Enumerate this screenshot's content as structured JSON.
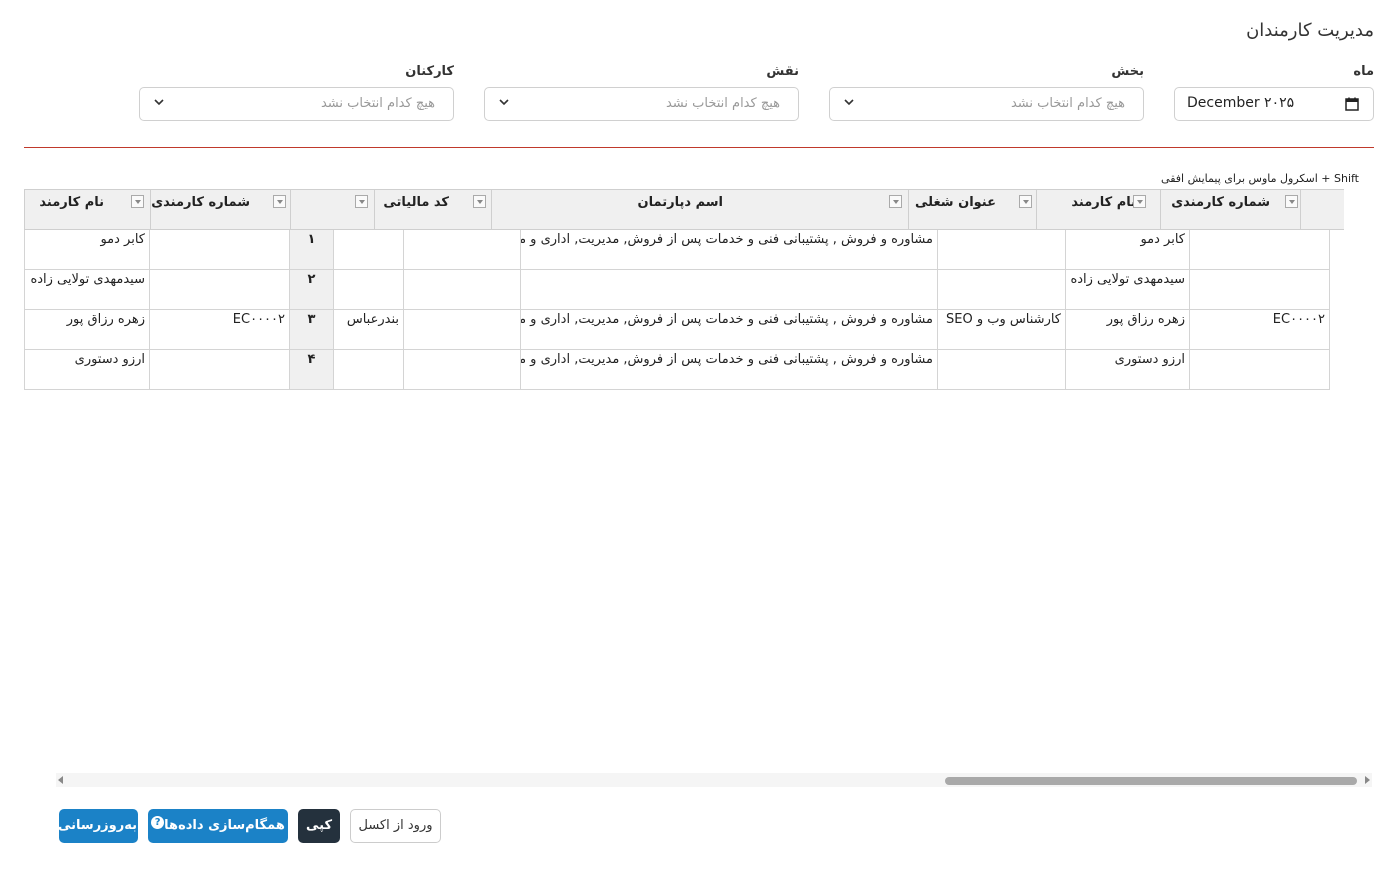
{
  "page": {
    "title": "مدیریت کارمندان"
  },
  "filters": {
    "month": {
      "label": "ماه",
      "value": "December ۲۰۲۵"
    },
    "section": {
      "label": "بخش",
      "placeholder": "هیچ کدام انتخاب نشد"
    },
    "role": {
      "label": "نقش",
      "placeholder": "هیچ کدام انتخاب نشد"
    },
    "staff": {
      "label": "کارکنان",
      "placeholder": "هیچ کدام انتخاب نشد"
    }
  },
  "grid": {
    "hint": "Shift + اسکرول ماوس برای پیمایش افقی",
    "headers": {
      "emp_number": "شماره کارمندی",
      "emp_name": "نام کارمند",
      "job_title": "عنوان شغلی",
      "dept_name": "اسم دپارتمان",
      "tax_code": "کد مالیاتی",
      "emp_number_2": "شماره کارمندی",
      "emp_name_2": "نام کارمند"
    },
    "rows": [
      {
        "emp_number": "",
        "emp_name": "کابر دمو",
        "job_title": "",
        "dept_name": "مشاوره و فروش , پشتیبانی فنی و خدمات پس از فروش, مدیریت, اداری و مالی",
        "tax_code": "",
        "city": "",
        "row_num": "۱",
        "emp_number_2": "",
        "emp_name_2": "کابر دمو"
      },
      {
        "emp_number": "",
        "emp_name": "سیدمهدی تولایی زاده",
        "job_title": "",
        "dept_name": "",
        "tax_code": "",
        "city": "",
        "row_num": "۲",
        "emp_number_2": "",
        "emp_name_2": "سیدمهدی تولایی زاده"
      },
      {
        "emp_number": "EC۰۰۰۰۲",
        "emp_name": "زهره رزاق پور",
        "job_title": "کارشناس وب و SEO",
        "dept_name": "مشاوره و فروش , پشتیبانی فنی و خدمات پس از فروش, مدیریت, اداری و مالی",
        "tax_code": "",
        "city": "بندرعباس",
        "row_num": "۳",
        "emp_number_2": "EC۰۰۰۰۲",
        "emp_name_2": "زهره رزاق پور"
      },
      {
        "emp_number": "",
        "emp_name": "ارزو دستوری",
        "job_title": "",
        "dept_name": "مشاوره و فروش , پشتیبانی فنی و خدمات پس از فروش, مدیریت, اداری و مالی",
        "tax_code": "",
        "city": "",
        "row_num": "۴",
        "emp_number_2": "",
        "emp_name_2": "ارزو دستوری"
      }
    ]
  },
  "actions": {
    "refresh": "به‌روزرسانی",
    "sync": "همگام‌سازی داده‌ها",
    "sync_help": "?",
    "copy": "کپی",
    "import_excel": "ورود از اکسل"
  },
  "colors": {
    "primary": "#1b82c7",
    "dark": "#24313d",
    "divider": "#c0392b"
  }
}
